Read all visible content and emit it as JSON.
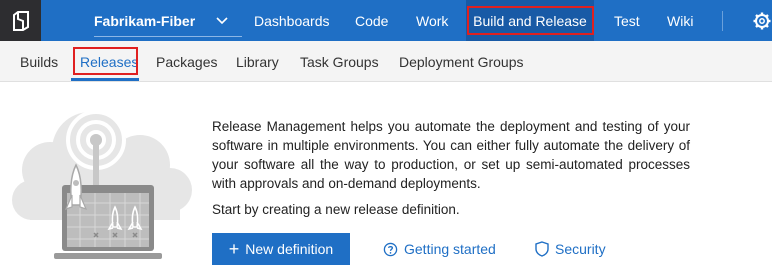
{
  "colors": {
    "topbar": "#1f6fc5",
    "logo_bg": "#2d2d30",
    "subnav_bg": "#f4f4f4",
    "accent": "#1f6fc5",
    "highlight": "#e02020"
  },
  "header": {
    "project": "Fabrikam-Fiber",
    "nav": [
      {
        "label": "Dashboards"
      },
      {
        "label": "Code"
      },
      {
        "label": "Work"
      },
      {
        "label": "Build and Release"
      },
      {
        "label": "Test"
      },
      {
        "label": "Wiki"
      }
    ]
  },
  "subnav": {
    "items": [
      {
        "label": "Builds"
      },
      {
        "label": "Releases"
      },
      {
        "label": "Packages"
      },
      {
        "label": "Library"
      },
      {
        "label": "Task Groups"
      },
      {
        "label": "Deployment Groups"
      }
    ]
  },
  "main": {
    "description": "Release Management helps you automate the deployment and testing of your software in multiple environments. You can either fully automate the delivery of your software all the way to production, or set up semi-automated processes with approvals and on-demand deployments.",
    "start_text": "Start by creating a new release definition.",
    "new_definition_label": "New definition",
    "getting_started_label": "Getting started",
    "security_label": "Security"
  }
}
